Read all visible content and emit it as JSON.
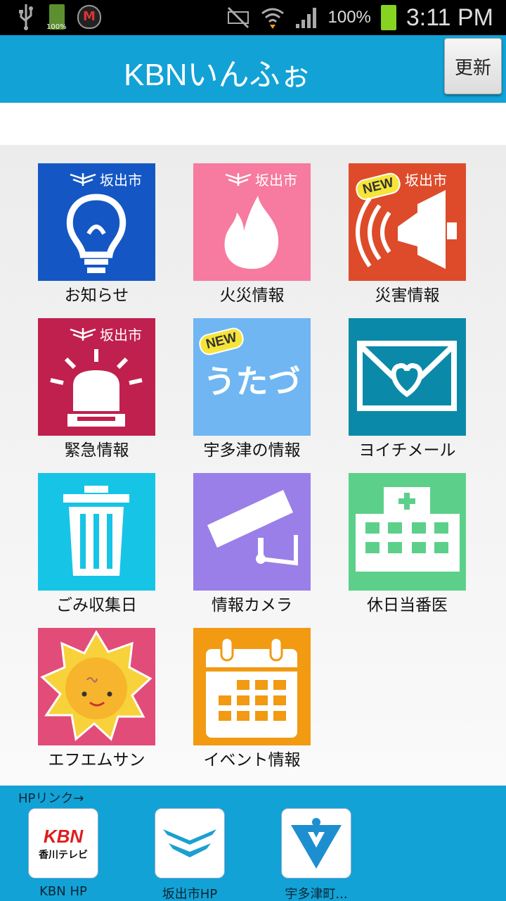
{
  "status_bar": {
    "battery_small_label": "100%",
    "battery_percent": "100%",
    "time": "3:11 PM"
  },
  "header": {
    "title": "KBNいんふぉ",
    "refresh_label": "更新"
  },
  "city_badge": "坂出市",
  "new_badge": "NEW",
  "tiles": [
    {
      "label": "お知らせ",
      "color": "#1457c4",
      "icon": "lightbulb-icon"
    },
    {
      "label": "火災情報",
      "color": "#f77aa0",
      "icon": "fire-icon"
    },
    {
      "label": "災害情報",
      "color": "#dd4b2a",
      "icon": "megaphone-icon"
    },
    {
      "label": "緊急情報",
      "color": "#c0204e",
      "icon": "siren-icon"
    },
    {
      "label": "宇多津の情報",
      "color": "#6fb6f2",
      "icon": "utazu-text-icon",
      "icon_text": "うたづ"
    },
    {
      "label": "ヨイチメール",
      "color": "#0a8aa8",
      "icon": "envelope-heart-icon"
    },
    {
      "label": "ごみ収集日",
      "color": "#16c4e6",
      "icon": "trash-can-icon"
    },
    {
      "label": "情報カメラ",
      "color": "#9a7fe8",
      "icon": "camera-icon"
    },
    {
      "label": "休日当番医",
      "color": "#5cd08a",
      "icon": "hospital-icon"
    },
    {
      "label": "エフエムサン",
      "color": "#e24c78",
      "icon": "sun-mascot-icon"
    },
    {
      "label": "イベント情報",
      "color": "#f19a12",
      "icon": "calendar-icon"
    }
  ],
  "links_bar": {
    "title": "HPリンク→",
    "links": [
      {
        "label": "KBN HP",
        "icon": "kbn-logo-icon",
        "logo_letters": "KBN",
        "logo_sub": "香川テレビ"
      },
      {
        "label": "坂出市HP",
        "icon": "sakaide-logo-icon"
      },
      {
        "label": "宇多津町...",
        "icon": "utazu-logo-icon"
      }
    ]
  },
  "colors": {
    "accent": "#12a2d6",
    "status_bar": "#000000"
  }
}
